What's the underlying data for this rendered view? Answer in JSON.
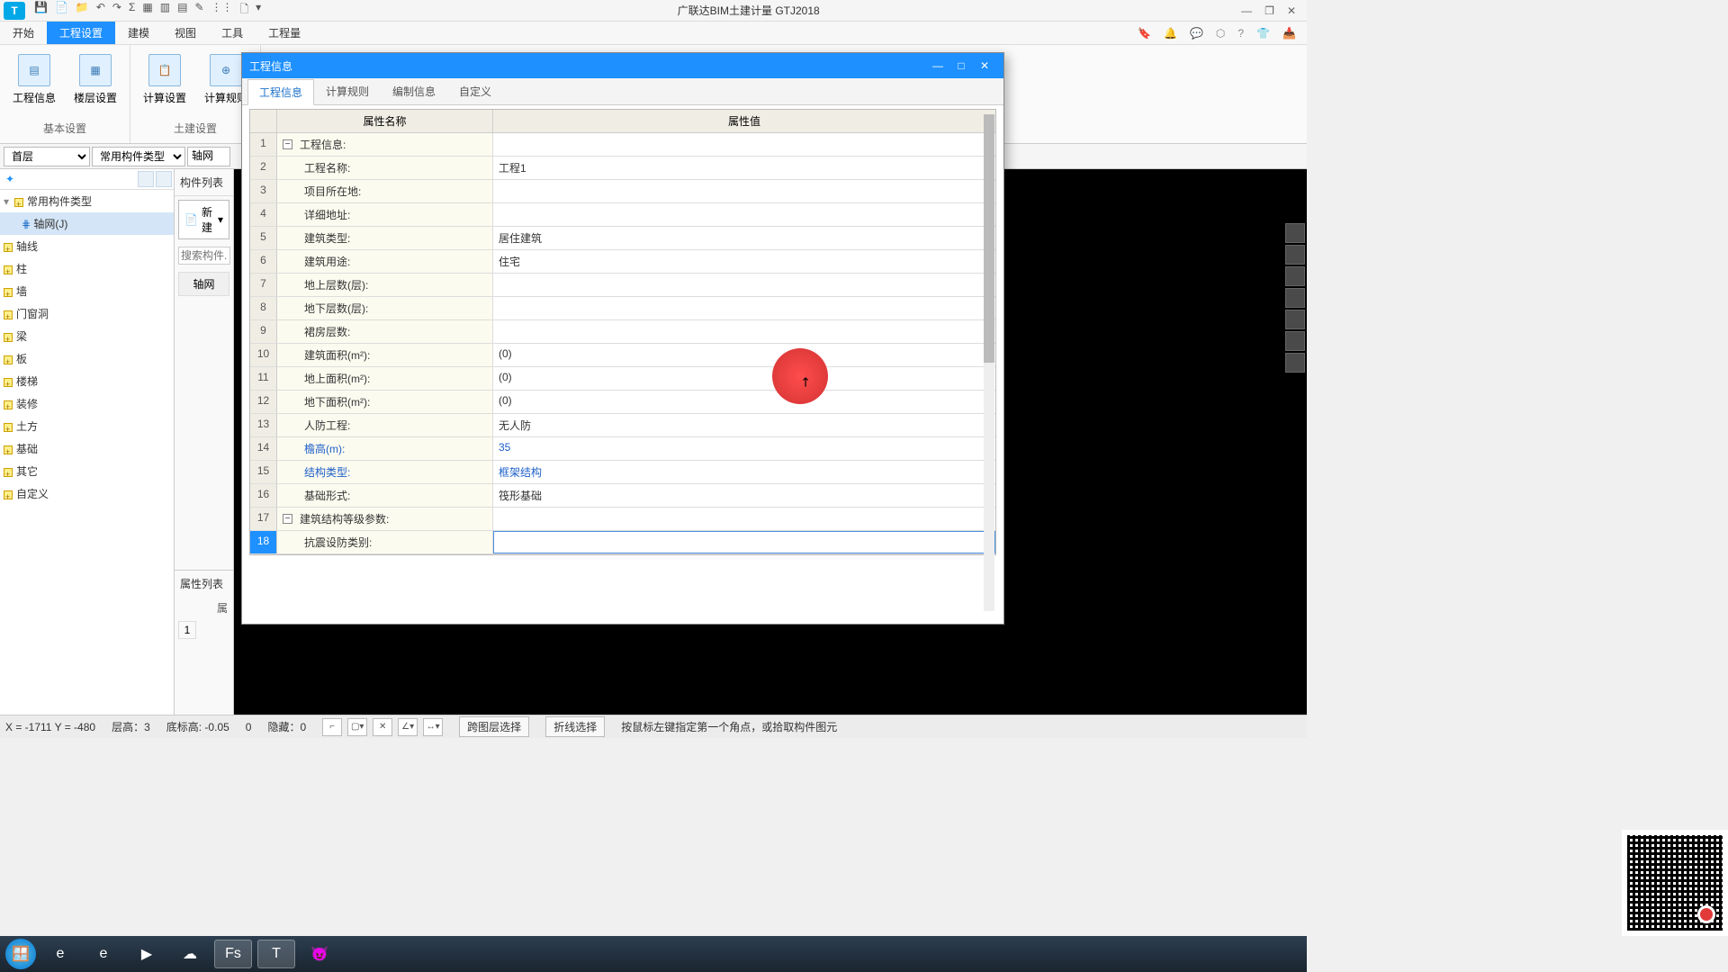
{
  "app": {
    "title": "广联达BIM土建计量 GTJ2018",
    "logo": "T"
  },
  "qat": [
    "💾",
    "📄",
    "📁",
    "↶",
    "↷",
    "Σ",
    "▦",
    "▥",
    "▤",
    "✎",
    "⋮⋮",
    "🗋",
    "▾"
  ],
  "winControls": {
    "min": "—",
    "max": "❐",
    "close": "✕"
  },
  "menuTabs": [
    {
      "label": "开始",
      "active": false
    },
    {
      "label": "工程设置",
      "active": true
    },
    {
      "label": "建模",
      "active": false
    },
    {
      "label": "视图",
      "active": false
    },
    {
      "label": "工具",
      "active": false
    },
    {
      "label": "工程量",
      "active": false
    }
  ],
  "menuRightIcons": [
    "🔖",
    "🔔",
    "💬",
    "⬡",
    "?",
    "👕",
    "📥"
  ],
  "ribbon": {
    "group1": {
      "label": "基本设置",
      "items": [
        {
          "icon": "▤",
          "label": "工程信息"
        },
        {
          "icon": "▦",
          "label": "楼层设置"
        }
      ]
    },
    "group2": {
      "label": "土建设置",
      "items": [
        {
          "icon": "📋",
          "label": "计算设置"
        },
        {
          "icon": "⊕",
          "label": "计算规则"
        }
      ]
    }
  },
  "filters": {
    "floor": "首层",
    "type": "常用构件类型",
    "item": "轴网"
  },
  "tree": {
    "root": "常用构件类型",
    "selectedChild": "轴网(J)",
    "nodes": [
      "轴线",
      "柱",
      "墙",
      "门窗洞",
      "梁",
      "板",
      "楼梯",
      "装修",
      "土方",
      "基础",
      "其它",
      "自定义"
    ]
  },
  "midPanel": {
    "header": "构件列表",
    "newBtn": "新建",
    "searchPlaceholder": "搜索构件...",
    "item": "轴网",
    "propHeader": "属性列表",
    "propLabel": "属",
    "propRow": "1"
  },
  "modal": {
    "title": "工程信息",
    "tabs": [
      {
        "label": "工程信息",
        "active": true
      },
      {
        "label": "计算规则",
        "active": false
      },
      {
        "label": "编制信息",
        "active": false
      },
      {
        "label": "自定义",
        "active": false
      }
    ],
    "headers": {
      "name": "属性名称",
      "value": "属性值"
    },
    "rows": [
      {
        "n": "1",
        "name": "工程信息:",
        "val": "",
        "group": true
      },
      {
        "n": "2",
        "name": "工程名称:",
        "val": "工程1"
      },
      {
        "n": "3",
        "name": "项目所在地:",
        "val": ""
      },
      {
        "n": "4",
        "name": "详细地址:",
        "val": ""
      },
      {
        "n": "5",
        "name": "建筑类型:",
        "val": "居住建筑"
      },
      {
        "n": "6",
        "name": "建筑用途:",
        "val": "住宅"
      },
      {
        "n": "7",
        "name": "地上层数(层):",
        "val": ""
      },
      {
        "n": "8",
        "name": "地下层数(层):",
        "val": ""
      },
      {
        "n": "9",
        "name": "裙房层数:",
        "val": ""
      },
      {
        "n": "10",
        "name": "建筑面积(m²):",
        "val": "(0)"
      },
      {
        "n": "11",
        "name": "地上面积(m²):",
        "val": "(0)"
      },
      {
        "n": "12",
        "name": "地下面积(m²):",
        "val": "(0)"
      },
      {
        "n": "13",
        "name": "人防工程:",
        "val": "无人防"
      },
      {
        "n": "14",
        "name": "檐高(m):",
        "val": "35",
        "link": true
      },
      {
        "n": "15",
        "name": "结构类型:",
        "val": "框架结构",
        "link": true
      },
      {
        "n": "16",
        "name": "基础形式:",
        "val": "筏形基础"
      },
      {
        "n": "17",
        "name": "建筑结构等级参数:",
        "val": "",
        "group": true
      },
      {
        "n": "18",
        "name": "抗震设防类别:",
        "val": "",
        "selected": true
      }
    ]
  },
  "statusbar": {
    "coords": "X = -1711 Y = -480",
    "floor": "层高：3",
    "bottom": "底标高: -0.05",
    "zero": "0",
    "hidden": "隐藏：0",
    "btn1": "跨图层选择",
    "btn2": "折线选择",
    "hint": "按鼠标左键指定第一个角点，或拾取构件图元"
  },
  "taskbarApps": [
    "🪟",
    "e",
    "e",
    "▶",
    "☁",
    "Fs",
    "T",
    "😈"
  ]
}
